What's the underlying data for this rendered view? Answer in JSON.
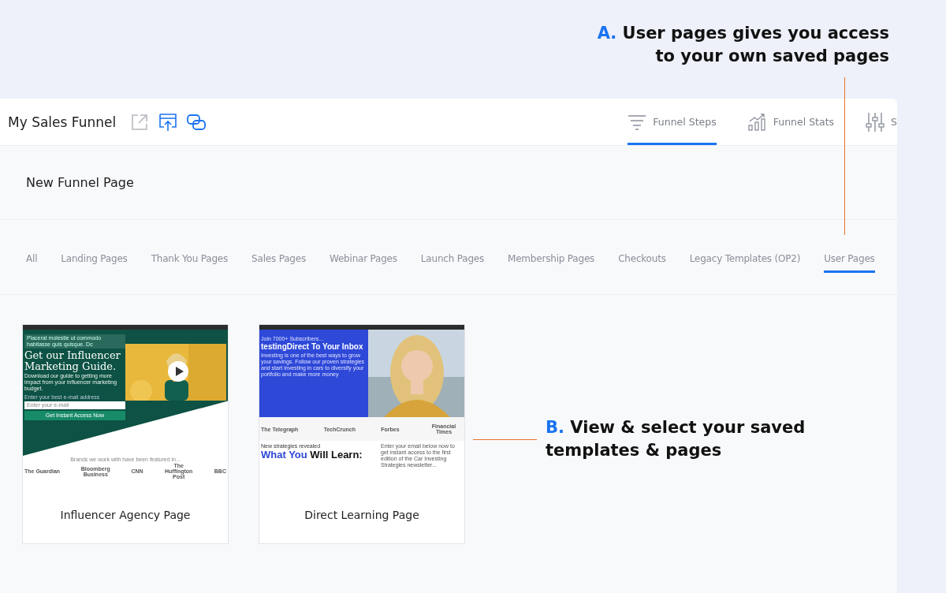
{
  "annotations": [
    {
      "letter": "A.",
      "text": "User pages gives you access to your own saved pages"
    },
    {
      "letter": "B.",
      "text": "View & select your saved templates & pages"
    }
  ],
  "header": {
    "title": "My Sales Funnel",
    "tabs": [
      {
        "label": "Funnel Steps",
        "selected": true
      },
      {
        "label": "Funnel Stats",
        "selected": false
      },
      {
        "label": "S",
        "selected": false
      }
    ]
  },
  "page_title": "New Funnel Page",
  "categories": [
    {
      "label": "All",
      "selected": false
    },
    {
      "label": "Landing Pages",
      "selected": false
    },
    {
      "label": "Thank You Pages",
      "selected": false
    },
    {
      "label": "Sales Pages",
      "selected": false
    },
    {
      "label": "Webinar Pages",
      "selected": false
    },
    {
      "label": "Launch Pages",
      "selected": false
    },
    {
      "label": "Membership Pages",
      "selected": false
    },
    {
      "label": "Checkouts",
      "selected": false
    },
    {
      "label": "Legacy Templates (OP2)",
      "selected": false
    },
    {
      "label": "User Pages",
      "selected": true
    }
  ],
  "templates": [
    {
      "name": "Influencer Agency Page",
      "preview": {
        "kind": "guide",
        "note": "Placerat molestie ut commodo habitasse quis quisque. Dc",
        "headline": "Get our Influencer Marketing Guide.",
        "body": "Download our guide to getting more impact from your influencer marketing budget.",
        "field_label": "Enter your best e-mail address",
        "placeholder": "Enter your e-mail",
        "button": "Get Instant Access Now",
        "featured": "Brands we work with have been featured in...",
        "logos": [
          "The Guardian",
          "Bloomberg Business",
          "CNN",
          "The Huffington Post",
          "BBC"
        ]
      }
    },
    {
      "name": "Direct Learning Page",
      "preview": {
        "kind": "newsletter",
        "eyebrow": "Join 7000+ Subscribers...",
        "headline": "testingDirect To Your Inbox",
        "body": "Investing is one of the best ways to grow your savings. Follow our proven strategies and start investing in cars to diversify your portfolio and make more money",
        "logos": [
          "The Telegraph",
          "TechCrunch",
          "Forbes",
          "Financial Times"
        ],
        "kicker": "New strategies revealed",
        "title_accent": "What You",
        "title_rest": "Will Learn:",
        "side_text": "Enter your email below now to get instant access to the first edition of the Car Investing Strategies newsletter..."
      }
    }
  ]
}
